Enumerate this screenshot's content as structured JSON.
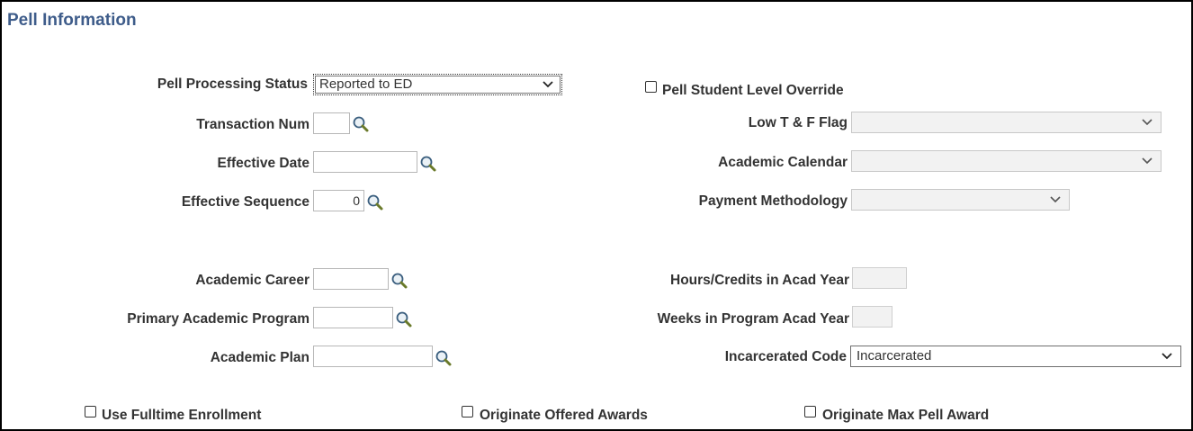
{
  "page": {
    "title": "Pell Information"
  },
  "left": {
    "pell_processing_status": {
      "label": "Pell Processing Status",
      "value": "Reported to ED"
    },
    "transaction_num": {
      "label": "Transaction Num",
      "value": ""
    },
    "effective_date": {
      "label": "Effective Date",
      "value": ""
    },
    "effective_sequence": {
      "label": "Effective Sequence",
      "value": "0"
    },
    "academic_career": {
      "label": "Academic Career",
      "value": ""
    },
    "primary_academic_program": {
      "label": "Primary Academic Program",
      "value": ""
    },
    "academic_plan": {
      "label": "Academic Plan",
      "value": ""
    }
  },
  "right": {
    "pell_student_level_override": {
      "label": "Pell Student Level Override",
      "checked": false
    },
    "low_tf_flag": {
      "label": "Low T & F Flag",
      "value": ""
    },
    "academic_calendar": {
      "label": "Academic Calendar",
      "value": ""
    },
    "payment_methodology": {
      "label": "Payment Methodology",
      "value": ""
    },
    "hours_credits": {
      "label": "Hours/Credits in Acad Year",
      "value": ""
    },
    "weeks_in_program": {
      "label": "Weeks in Program Acad Year",
      "value": ""
    },
    "incarcerated_code": {
      "label": "Incarcerated Code",
      "value": "Incarcerated"
    }
  },
  "bottom": {
    "use_fulltime_enrollment": {
      "label": "Use Fulltime Enrollment",
      "checked": false
    },
    "originate_offered_awards": {
      "label": "Originate Offered Awards",
      "checked": false
    },
    "originate_max_pell_award": {
      "label": "Originate Max Pell Award",
      "checked": false
    }
  },
  "icons": {
    "lookup": "magnifier-icon",
    "dropdown": "chevron-down-icon"
  }
}
